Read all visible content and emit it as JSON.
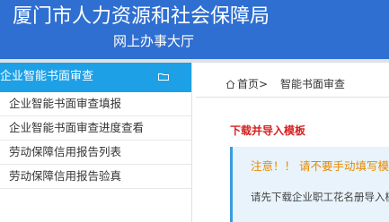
{
  "header": {
    "title": "厦门市人力资源和社会保障局",
    "subtitle": "网上办事大厅"
  },
  "sidebar": {
    "group_title": "企业智能书面审查",
    "group_icon": "folder-icon",
    "items": [
      {
        "label": "企业智能书面审查填报"
      },
      {
        "label": "企业智能书面审查进度查看"
      },
      {
        "label": "劳动保障信用报告列表"
      },
      {
        "label": "劳动保障信用报告验真"
      }
    ]
  },
  "breadcrumb": {
    "home_icon": "home-icon",
    "home": "首页>",
    "current": "智能书面审查"
  },
  "main": {
    "section_title": "下载并导入模板",
    "notice_warning": "注意！！ 请不要手动填写模板",
    "notice_text": "请先下载企业职工花名册导入模板"
  },
  "colors": {
    "header_bg": "#2f6fd1",
    "sidebar_head_bg": "#1ea0e6",
    "section_title": "#d61f1f",
    "notice_warning": "#e68a00",
    "notice_bg": "#e8f3fb"
  }
}
